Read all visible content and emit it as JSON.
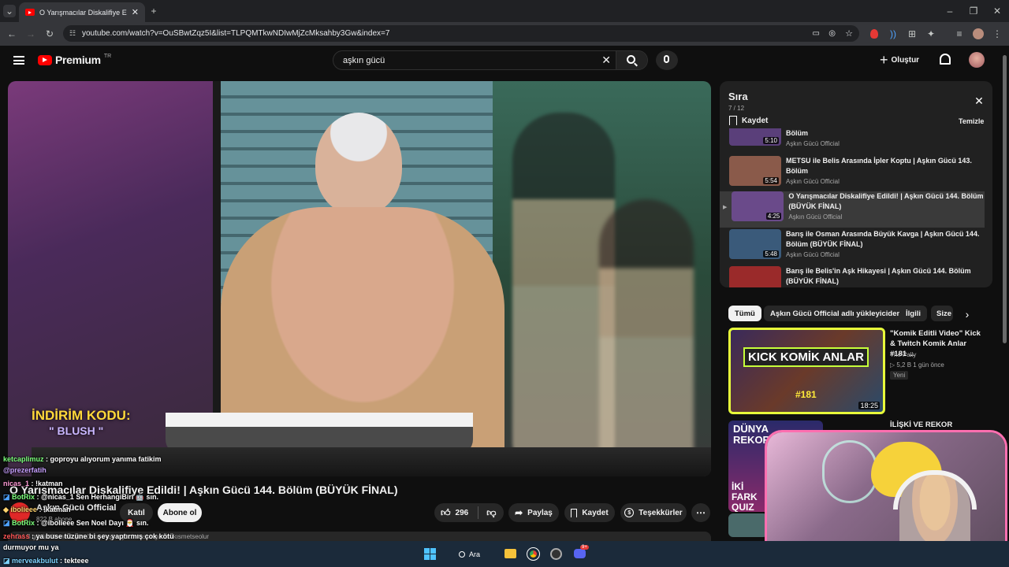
{
  "browser": {
    "tab_title": "O Yarışmacılar Diskalifiye Edildi",
    "url": "youtube.com/watch?v=OuSBwtZqz5I&list=TLPQMTkwNDIwMjZcMksahby3Gw&index=7"
  },
  "youtube": {
    "logo_text": "Premium",
    "logo_region": "TR",
    "search_value": "aşkın gücü",
    "create_label": "Oluştur"
  },
  "player": {
    "overlay_line1": "İNDİRİM KODU:",
    "overlay_line2": "\" BLUSH \""
  },
  "video": {
    "title": "O Yarışmacılar Diskalifiye Edildi! | Aşkın Gücü 144. Bölüm (BÜYÜK FİNAL)",
    "channel": "Aşkın Gücü Official",
    "subscribers": "822 B abone",
    "join_label": "Katıl",
    "subscribe_label": "Abone ol",
    "like_count": "296",
    "share_label": "Paylaş",
    "save_label": "Kaydet",
    "thanks_label": "Teşekkürler",
    "description_peek": "3.4 B görüntüleme  1 gün önce  #aşkıngücü #askingucu #kısmetseolur"
  },
  "queue": {
    "title": "Sıra",
    "position": "7 / 12",
    "save_label": "Kaydet",
    "clear_label": "Temizle",
    "items": [
      {
        "title": "Bölüm",
        "channel": "Aşkın Gücü Official",
        "duration": "5:10",
        "color": "#5a3f7a"
      },
      {
        "title": "METSU ile Belis Arasında İpler Koptu | Aşkın Gücü 143. Bölüm",
        "channel": "Aşkın Gücü Official",
        "duration": "5:54",
        "color": "#8a5a4a"
      },
      {
        "title": "O Yarışmacılar Diskalifiye Edildi! | Aşkın Gücü 144. Bölüm (BÜYÜK FİNAL)",
        "channel": "Aşkın Gücü Official",
        "duration": "4:25",
        "color": "#6a4a8a"
      },
      {
        "title": "Barış ile Osman Arasında Büyük Kavga | Aşkın Gücü 144. Bölüm (BÜYÜK FİNAL)",
        "channel": "Aşkın Gücü Official",
        "duration": "5:48",
        "color": "#3a5a7a"
      },
      {
        "title": "Barış ile Belis'in Aşk Hikayesi | Aşkın Gücü 144. Bölüm (BÜYÜK FİNAL)",
        "channel": "",
        "duration": "",
        "color": "#9a2a2a"
      }
    ]
  },
  "chips": [
    "Tümü",
    "Aşkın Gücü Official adlı yükleyiciden",
    "İlgili",
    "Size"
  ],
  "recommendations": [
    {
      "title": "\"Komik Editli Video\" Kick & Twitch Komik Anlar #181 ...",
      "channel": "The Pally",
      "meta": "▷ 5,2 B  1 gün önce",
      "badge": "Yeni",
      "duration": "18:25",
      "thumb_text": "KICK KOMİK ANLAR",
      "thumb_num": "#181"
    },
    {
      "title": "İLİŞKİ VE REKOR",
      "thumb_text": "DÜNYA REKORLARI",
      "thumb_text2": "İKİ FARK QUIZ"
    }
  ],
  "chat": [
    {
      "user": "ketcaplimuz",
      "text": " : goproyu alıyorum yanıma fatikim",
      "color": "#7dff7d"
    },
    {
      "user": "@prezerfatih",
      "text": "",
      "color": "#c6a0ff"
    },
    {
      "user": "nicas_1",
      "text": " : !katman",
      "color": "#ff9bd6"
    },
    {
      "user": "BotRix",
      "text": " : @nicas_1 Sen HerhangiBiri 🤖 sın.",
      "color": "#7dff7d"
    },
    {
      "user": "ibolieee",
      "text": " : !katman",
      "color": "#ffd36e"
    },
    {
      "user": "BotRix",
      "text": " : @ibolieee Sen Noel Dayı 🎅 sın.",
      "color": "#7dff7d"
    },
    {
      "user": "zehrass",
      "text": " : ya buse tüzüne bi şey yaptırmış çok kötü",
      "color": "#ff5555"
    },
    {
      "user": "",
      "text": "durmuyor mu ya",
      "color": "#ffffff"
    },
    {
      "user": "merveakbulut",
      "text": " : tekteee",
      "color": "#7dd3ff"
    }
  ],
  "taskbar": {
    "search_label": "Ara",
    "discord_badge": "9+"
  }
}
